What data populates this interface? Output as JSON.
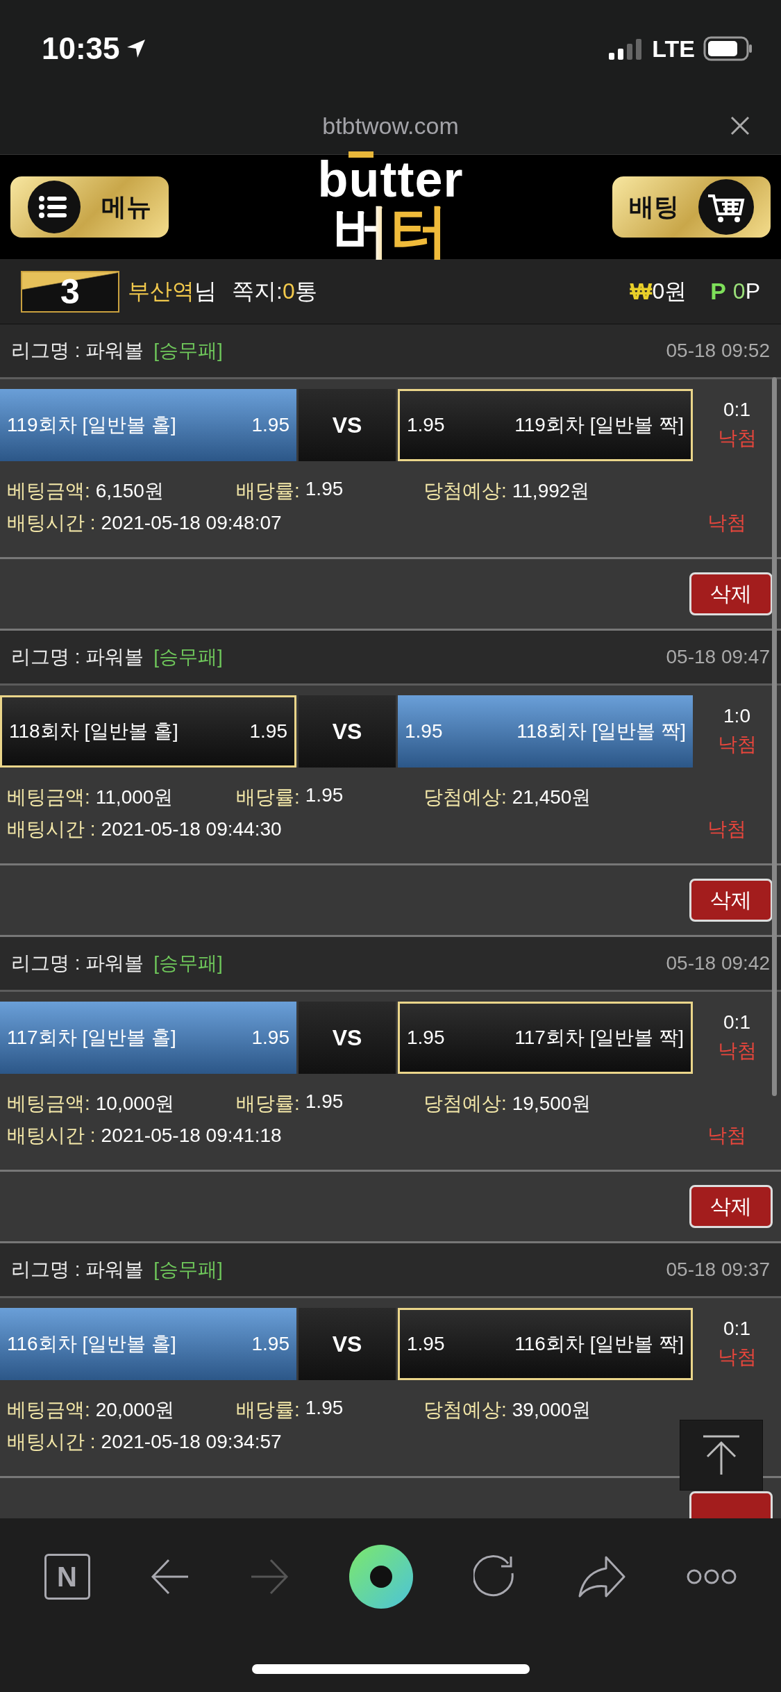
{
  "status_bar": {
    "time": "10:35",
    "network": "LTE"
  },
  "browser": {
    "url": "btbtwow.com"
  },
  "header": {
    "menu_label": "메뉴",
    "logo_top": "butter",
    "logo_bottom": "버터",
    "bet_label": "배팅"
  },
  "user_bar": {
    "level": "3",
    "name": "부산역",
    "name_suffix": "님",
    "messages_label": "쪽지:",
    "messages_count": "0",
    "messages_unit": "통",
    "won_symbol": "₩",
    "money": "0원",
    "point_symbol": "P",
    "points": "0",
    "points_unit": "P"
  },
  "bets": [
    {
      "league": "리그명 : 파워볼",
      "market": "[승무패]",
      "time": "05-18 09:52",
      "sides": [
        {
          "name": "119회차 [일반볼 홀]",
          "odds": "1.95",
          "selected": false
        },
        {
          "name": "119회차 [일반볼 짝]",
          "odds": "1.95",
          "selected": true
        }
      ],
      "vs": "VS",
      "score": "0:1",
      "result": "낙첨",
      "amount_label": "베팅금액:",
      "amount": "6,150원",
      "odds_label": "배당률:",
      "odds": "1.95",
      "expected_label": "당첨예상:",
      "expected": "11,992원",
      "time_label": "배팅시간 :",
      "bet_time": "2021-05-18 09:48:07",
      "status": "낙첨",
      "delete_label": "삭제"
    },
    {
      "league": "리그명 : 파워볼",
      "market": "[승무패]",
      "time": "05-18 09:47",
      "sides": [
        {
          "name": "118회차 [일반볼 홀]",
          "odds": "1.95",
          "selected": true
        },
        {
          "name": "118회차 [일반볼 짝]",
          "odds": "1.95",
          "selected": false
        }
      ],
      "vs": "VS",
      "score": "1:0",
      "result": "낙첨",
      "amount_label": "베팅금액:",
      "amount": "11,000원",
      "odds_label": "배당률:",
      "odds": "1.95",
      "expected_label": "당첨예상:",
      "expected": "21,450원",
      "time_label": "배팅시간 :",
      "bet_time": "2021-05-18 09:44:30",
      "status": "낙첨",
      "delete_label": "삭제"
    },
    {
      "league": "리그명 : 파워볼",
      "market": "[승무패]",
      "time": "05-18 09:42",
      "sides": [
        {
          "name": "117회차 [일반볼 홀]",
          "odds": "1.95",
          "selected": false
        },
        {
          "name": "117회차 [일반볼 짝]",
          "odds": "1.95",
          "selected": true
        }
      ],
      "vs": "VS",
      "score": "0:1",
      "result": "낙첨",
      "amount_label": "베팅금액:",
      "amount": "10,000원",
      "odds_label": "배당률:",
      "odds": "1.95",
      "expected_label": "당첨예상:",
      "expected": "19,500원",
      "time_label": "배팅시간 :",
      "bet_time": "2021-05-18 09:41:18",
      "status": "낙첨",
      "delete_label": "삭제"
    },
    {
      "league": "리그명 : 파워볼",
      "market": "[승무패]",
      "time": "05-18 09:37",
      "sides": [
        {
          "name": "116회차 [일반볼 홀]",
          "odds": "1.95",
          "selected": false
        },
        {
          "name": "116회차 [일반볼 짝]",
          "odds": "1.95",
          "selected": true
        }
      ],
      "vs": "VS",
      "score": "0:1",
      "result": "낙첨",
      "amount_label": "베팅금액:",
      "amount": "20,000원",
      "odds_label": "배당률:",
      "odds": "1.95",
      "expected_label": "당첨예상:",
      "expected": "39,000원",
      "time_label": "배팅시간 :",
      "bet_time": "2021-05-18 09:34:57"
    }
  ],
  "toolbar": {
    "home_label": "N",
    "forward_disabled": true
  }
}
